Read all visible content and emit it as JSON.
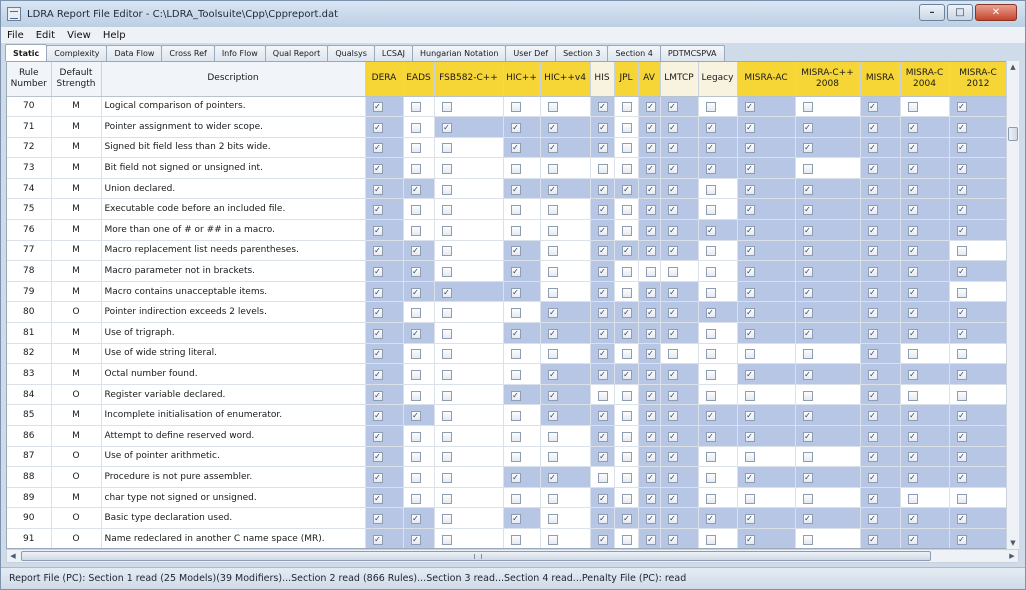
{
  "window": {
    "title": "LDRA Report File Editor - C:\\LDRA_Toolsuite\\Cpp\\Cppreport.dat"
  },
  "menu": [
    "File",
    "Edit",
    "View",
    "Help"
  ],
  "tabs": [
    "Static",
    "Complexity",
    "Data Flow",
    "Cross Ref",
    "Info Flow",
    "Qual Report",
    "Qualsys",
    "LCSAJ",
    "Hungarian Notation",
    "User Def",
    "Section 3",
    "Section 4",
    "PDTMCSPVA"
  ],
  "active_tab": "Static",
  "colors": {
    "header_yellow": "#f6d536",
    "cell_selected": "#b6c6e4",
    "header_light": "#f7f3de"
  },
  "columns": [
    {
      "label": "Rule Number",
      "style": "plain"
    },
    {
      "label": "Default Strength",
      "style": "plain"
    },
    {
      "label": "Description",
      "style": "plain"
    },
    {
      "label": "DERA",
      "style": "yellow"
    },
    {
      "label": "EADS",
      "style": "yellow"
    },
    {
      "label": "FSB582-C++",
      "style": "yellow"
    },
    {
      "label": "HIC++",
      "style": "yellow"
    },
    {
      "label": "HIC++v4",
      "style": "yellow"
    },
    {
      "label": "HIS",
      "style": "light"
    },
    {
      "label": "JPL",
      "style": "yellow"
    },
    {
      "label": "AV",
      "style": "yellow"
    },
    {
      "label": "LMTCP",
      "style": "light"
    },
    {
      "label": "Legacy",
      "style": "light"
    },
    {
      "label": "MISRA-AC",
      "style": "yellow"
    },
    {
      "label": "MISRA-C++ 2008",
      "style": "yellow"
    },
    {
      "label": "MISRA",
      "style": "yellow"
    },
    {
      "label": "MISRA-C 2004",
      "style": "yellow"
    },
    {
      "label": "MISRA-C 2012",
      "style": "yellow"
    }
  ],
  "rows": [
    {
      "rule": "70",
      "strength": "M",
      "desc": "Logical comparison of pointers.",
      "flags": [
        1,
        0,
        0,
        0,
        0,
        1,
        0,
        1,
        1,
        0,
        1,
        0,
        1,
        0,
        1
      ]
    },
    {
      "rule": "71",
      "strength": "M",
      "desc": "Pointer assignment to wider scope.",
      "flags": [
        1,
        0,
        1,
        1,
        1,
        1,
        0,
        1,
        1,
        1,
        1,
        1,
        1,
        1,
        1
      ]
    },
    {
      "rule": "72",
      "strength": "M",
      "desc": "Signed bit field less than 2 bits wide.",
      "flags": [
        1,
        0,
        0,
        1,
        1,
        1,
        0,
        1,
        1,
        1,
        1,
        1,
        1,
        1,
        1
      ]
    },
    {
      "rule": "73",
      "strength": "M",
      "desc": "Bit field not signed or unsigned int.",
      "flags": [
        1,
        0,
        0,
        0,
        0,
        0,
        0,
        1,
        1,
        1,
        1,
        0,
        1,
        1,
        1
      ]
    },
    {
      "rule": "74",
      "strength": "M",
      "desc": "Union declared.",
      "flags": [
        1,
        1,
        0,
        1,
        1,
        1,
        1,
        1,
        1,
        0,
        1,
        1,
        1,
        1,
        1
      ]
    },
    {
      "rule": "75",
      "strength": "M",
      "desc": "Executable code before an included file.",
      "flags": [
        1,
        0,
        0,
        0,
        0,
        1,
        0,
        1,
        1,
        0,
        1,
        1,
        1,
        1,
        1
      ]
    },
    {
      "rule": "76",
      "strength": "M",
      "desc": "More than one of # or ## in a macro.",
      "flags": [
        1,
        0,
        0,
        0,
        0,
        1,
        0,
        1,
        1,
        1,
        1,
        1,
        1,
        1,
        1
      ]
    },
    {
      "rule": "77",
      "strength": "M",
      "desc": "Macro replacement list needs parentheses.",
      "flags": [
        1,
        1,
        0,
        1,
        0,
        1,
        1,
        1,
        1,
        0,
        1,
        1,
        1,
        1,
        0
      ]
    },
    {
      "rule": "78",
      "strength": "M",
      "desc": "Macro parameter not in brackets.",
      "flags": [
        1,
        1,
        0,
        1,
        0,
        1,
        0,
        0,
        0,
        0,
        1,
        1,
        1,
        1,
        1
      ]
    },
    {
      "rule": "79",
      "strength": "M",
      "desc": "Macro contains unacceptable items.",
      "flags": [
        1,
        1,
        1,
        1,
        0,
        1,
        0,
        1,
        1,
        0,
        1,
        1,
        1,
        1,
        0
      ]
    },
    {
      "rule": "80",
      "strength": "O",
      "desc": "Pointer indirection exceeds 2 levels.",
      "flags": [
        1,
        0,
        0,
        0,
        1,
        1,
        1,
        1,
        1,
        1,
        1,
        1,
        1,
        1,
        1
      ]
    },
    {
      "rule": "81",
      "strength": "M",
      "desc": "Use of trigraph.",
      "flags": [
        1,
        1,
        0,
        1,
        1,
        1,
        1,
        1,
        1,
        0,
        1,
        1,
        1,
        1,
        1
      ]
    },
    {
      "rule": "82",
      "strength": "M",
      "desc": "Use of wide string literal.",
      "flags": [
        1,
        0,
        0,
        0,
        0,
        1,
        0,
        1,
        0,
        0,
        0,
        0,
        1,
        0,
        0
      ]
    },
    {
      "rule": "83",
      "strength": "M",
      "desc": "Octal number found.",
      "flags": [
        1,
        0,
        0,
        0,
        1,
        1,
        1,
        1,
        1,
        0,
        1,
        1,
        1,
        1,
        1
      ]
    },
    {
      "rule": "84",
      "strength": "O",
      "desc": "Register variable declared.",
      "flags": [
        1,
        0,
        0,
        1,
        1,
        0,
        0,
        1,
        1,
        0,
        0,
        0,
        1,
        0,
        0
      ]
    },
    {
      "rule": "85",
      "strength": "M",
      "desc": "Incomplete initialisation of enumerator.",
      "flags": [
        1,
        1,
        0,
        0,
        1,
        1,
        0,
        1,
        1,
        1,
        1,
        1,
        1,
        1,
        1
      ]
    },
    {
      "rule": "86",
      "strength": "M",
      "desc": "Attempt to define reserved word.",
      "flags": [
        1,
        0,
        0,
        0,
        0,
        1,
        0,
        1,
        1,
        1,
        1,
        1,
        1,
        1,
        1
      ]
    },
    {
      "rule": "87",
      "strength": "O",
      "desc": "Use of pointer arithmetic.",
      "flags": [
        1,
        0,
        0,
        0,
        0,
        1,
        0,
        1,
        1,
        0,
        0,
        0,
        1,
        1,
        1
      ]
    },
    {
      "rule": "88",
      "strength": "O",
      "desc": "Procedure is not pure assembler.",
      "flags": [
        1,
        0,
        0,
        1,
        1,
        0,
        0,
        1,
        1,
        0,
        1,
        1,
        1,
        1,
        1
      ]
    },
    {
      "rule": "89",
      "strength": "M",
      "desc": "char type not signed or unsigned.",
      "flags": [
        1,
        0,
        0,
        0,
        0,
        1,
        0,
        1,
        1,
        0,
        0,
        0,
        1,
        0,
        0
      ]
    },
    {
      "rule": "90",
      "strength": "O",
      "desc": "Basic type declaration used.",
      "flags": [
        1,
        1,
        0,
        1,
        0,
        1,
        1,
        1,
        1,
        1,
        1,
        1,
        1,
        1,
        1
      ]
    },
    {
      "rule": "91",
      "strength": "O",
      "desc": "Name redeclared in another C name space (MR).",
      "flags": [
        1,
        1,
        0,
        0,
        0,
        1,
        0,
        1,
        1,
        0,
        1,
        0,
        1,
        1,
        1
      ]
    }
  ],
  "status": "Report File (PC): Section 1 read (25 Models)(39 Modifiers)...Section 2 read (866 Rules)...Section 3 read...Section 4 read...Penalty File (PC): read"
}
